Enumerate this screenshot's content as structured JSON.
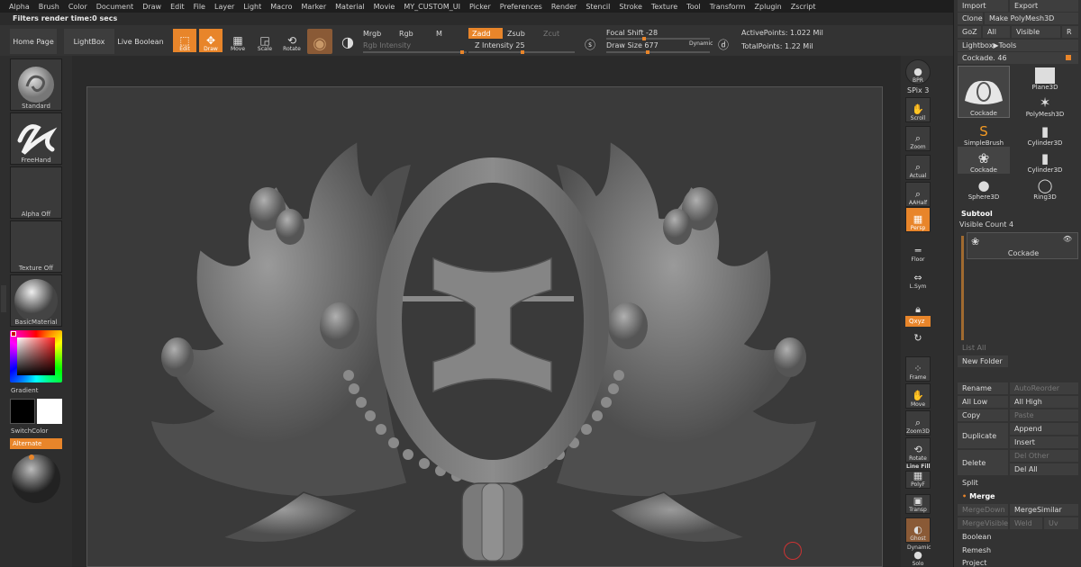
{
  "menu": [
    "Alpha",
    "Brush",
    "Color",
    "Document",
    "Draw",
    "Edit",
    "File",
    "Layer",
    "Light",
    "Macro",
    "Marker",
    "Material",
    "Movie",
    "MY_CUSTOM_UI",
    "Picker",
    "Preferences",
    "Render",
    "Stencil",
    "Stroke",
    "Texture",
    "Tool",
    "Transform",
    "Zplugin",
    "Zscript"
  ],
  "notice": "Filters render time:0 secs",
  "toolbar": {
    "home": "Home Page",
    "lightbox": "LightBox",
    "live_boolean": "Live Boolean",
    "edit": "Edit",
    "draw": "Draw",
    "move": "Move",
    "scale": "Scale",
    "rotate": "Rotate",
    "mrgb": "Mrgb",
    "rgb": "Rgb",
    "m": "M",
    "rgb_intensity": "Rgb Intensity",
    "zadd": "Zadd",
    "zsub": "Zsub",
    "zcut": "Zcut",
    "z_intensity_label": "Z Intensity",
    "z_intensity": "25",
    "focal_shift_label": "Focal Shift",
    "focal_shift": "-28",
    "draw_size_label": "Draw Size",
    "draw_size": "677",
    "dynamic": "Dynamic",
    "active_points": "ActivePoints: 1.022 Mil",
    "total_points": "TotalPoints: 1.22 Mil"
  },
  "left_tray": {
    "brush": "Standard",
    "stroke": "FreeHand",
    "alpha": "Alpha Off",
    "texture": "Texture Off",
    "material": "BasicMaterial",
    "gradient": "Gradient",
    "switch_color": "SwitchColor",
    "alternate": "Alternate"
  },
  "right_shelf": {
    "bpr": "BPR",
    "spix": "SPix 3",
    "scroll": "Scroll",
    "zoom": "Zoom",
    "actual": "Actual",
    "aahalf": "AAHalf",
    "persp": "Persp",
    "floor": "Floor",
    "lsym": "L.Sym",
    "xyz": "Qxyz",
    "frame": "Frame",
    "move": "Move",
    "zoom3d": "Zoom3D",
    "rotate": "Rotate",
    "linefill": "Line Fill",
    "polyf": "PolyF",
    "transp": "Transp",
    "ghost": "Ghost",
    "dynamic": "Dynamic",
    "solo": "Solo"
  },
  "palette": {
    "import": "Import",
    "export": "Export",
    "clone": "Clone",
    "make_polymesh": "Make PolyMesh3D",
    "goz": "GoZ",
    "all": "All",
    "visible": "Visible",
    "r": "R",
    "lightbox_tools": "Lightbox▶Tools",
    "cockade_label": "Cockade.",
    "cockade_value": "46",
    "tools": [
      "Cockade",
      "PolyMesh3D",
      "SimpleBrush",
      "Cylinder3D",
      "Cockade",
      "Cylinder3D",
      "Sphere3D",
      "Ring3D"
    ],
    "plane3d": "Plane3D",
    "subtool": "Subtool",
    "visible_count": "Visible Count 4",
    "subtool_name": "Cockade",
    "list_all": "List All",
    "new_folder": "New Folder",
    "rename": "Rename",
    "autoreorder": "AutoReorder",
    "all_low": "All Low",
    "all_high": "All High",
    "copy": "Copy",
    "paste": "Paste",
    "append": "Append",
    "duplicate": "Duplicate",
    "insert": "Insert",
    "del_other": "Del Other",
    "delete": "Delete",
    "del_all": "Del All",
    "split": "Split",
    "merge": "Merge",
    "merge_down": "MergeDown",
    "merge_similar": "MergeSimilar",
    "merge_visible": "MergeVisible",
    "weld": "Weld",
    "uv": "Uv",
    "boolean": "Boolean",
    "remesh": "Remesh",
    "project": "Project"
  },
  "colors": {
    "accent": "#e8852a",
    "panel": "#333333",
    "canvas": "#3a3a3a"
  }
}
